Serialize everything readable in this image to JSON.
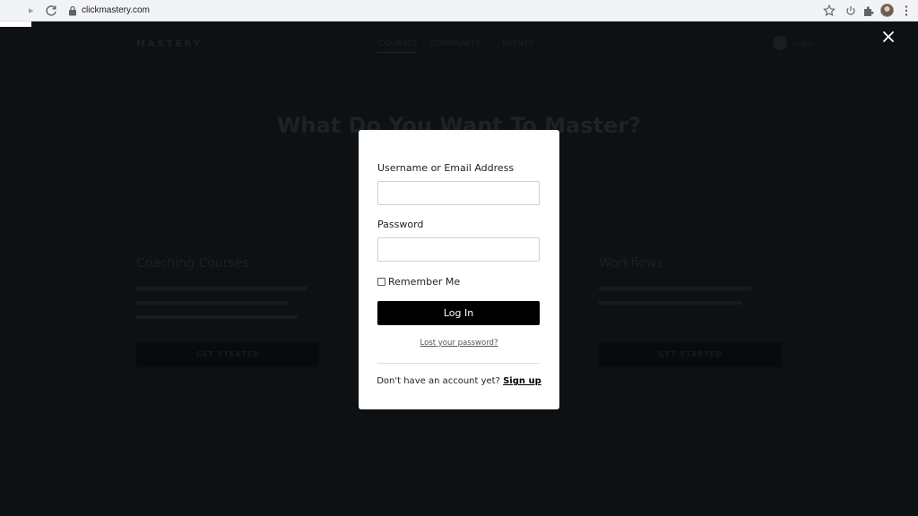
{
  "browser": {
    "url": "clickmastery.com",
    "icons": {
      "forward": "forward-arrow-icon",
      "reload": "reload-icon",
      "lock": "lock-icon",
      "star": "star-icon",
      "power": "power-icon",
      "extensions": "puzzle-icon",
      "profile": "avatar",
      "menu": "kebab-menu-icon"
    }
  },
  "overlay": {
    "close_icon": "close-icon"
  },
  "login_modal": {
    "username_label": "Username or Email Address",
    "username_value": "",
    "password_label": "Password",
    "password_value": "",
    "remember_label": "Remember Me",
    "remember_checked": false,
    "login_button": "Log In",
    "lost_password": "Lost your password?",
    "signup_prompt": "Don't have an account yet?",
    "signup_link": "Sign up"
  },
  "background_page": {
    "heading": "What Do You Want To Master?",
    "left_column_title": "Coaching Courses",
    "right_column_title": "Workflows"
  },
  "colors": {
    "overlay_bg": "#0d1114",
    "modal_bg": "#ffffff",
    "button_bg": "#000000",
    "button_text": "#ffffff"
  }
}
